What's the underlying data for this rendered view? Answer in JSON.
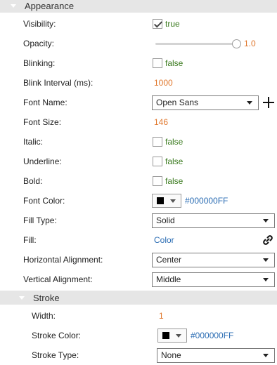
{
  "appearance": {
    "title": "Appearance",
    "visibility": {
      "label": "Visibility:",
      "checked": true,
      "text": "true"
    },
    "opacity": {
      "label": "Opacity:",
      "value": 1.0,
      "text": "1.0"
    },
    "blinking": {
      "label": "Blinking:",
      "checked": false,
      "text": "false"
    },
    "blink_interval": {
      "label": "Blink Interval (ms):",
      "value": "1000"
    },
    "font_name": {
      "label": "Font Name:",
      "value": "Open Sans"
    },
    "font_size": {
      "label": "Font Size:",
      "value": "146"
    },
    "italic": {
      "label": "Italic:",
      "checked": false,
      "text": "false"
    },
    "underline": {
      "label": "Underline:",
      "checked": false,
      "text": "false"
    },
    "bold": {
      "label": "Bold:",
      "checked": false,
      "text": "false"
    },
    "font_color": {
      "label": "Font Color:",
      "value": "#000000FF",
      "swatch": "#000000"
    },
    "fill_type": {
      "label": "Fill Type:",
      "value": "Solid"
    },
    "fill": {
      "label": "Fill:",
      "value": "Color"
    },
    "horizontal_alignment": {
      "label": "Horizontal Alignment:",
      "value": "Center"
    },
    "vertical_alignment": {
      "label": "Vertical Alignment:",
      "value": "Middle"
    }
  },
  "stroke": {
    "title": "Stroke",
    "width": {
      "label": "Width:",
      "value": "1"
    },
    "stroke_color": {
      "label": "Stroke Color:",
      "value": "#000000FF",
      "swatch": "#000000"
    },
    "stroke_type": {
      "label": "Stroke Type:",
      "value": "None"
    }
  },
  "icons": {
    "collapse": "triangle-down-icon",
    "add_font": "plus-icon",
    "link": "link-icon",
    "dropdown": "chevron-down-icon"
  },
  "colors": {
    "numeric": "#e0772c",
    "boolean": "#3a7a1e",
    "link": "#2a6cb3",
    "header_bg": "#e6e6e6"
  }
}
